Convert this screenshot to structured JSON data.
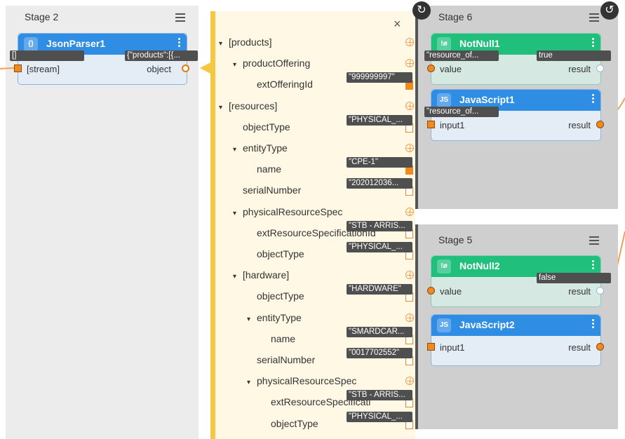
{
  "stage2": {
    "title": "Stage 2",
    "node": {
      "name": "JsonParser1",
      "icon": "{}",
      "input_label": "[stream]",
      "input_tag": "[]",
      "output_label": "object",
      "output_tag": "{\"products\":[{..."
    }
  },
  "mapper": {
    "close": "×",
    "items": [
      {
        "label": "[products]",
        "chev": "▾"
      },
      {
        "label": "productOffering",
        "chev": "▾"
      },
      {
        "label": "extOfferingId",
        "chev": "",
        "tag": "\"999999997\""
      },
      {
        "label": "[resources]",
        "chev": "▾"
      },
      {
        "label": "objectType",
        "chev": "",
        "tag": "\"PHYSICAL_..."
      },
      {
        "label": "entityType",
        "chev": "▾"
      },
      {
        "label": "name",
        "chev": "",
        "tag": "\"CPE-1\""
      },
      {
        "label": "serialNumber",
        "chev": "",
        "tag": "\"202012036..."
      },
      {
        "label": "physicalResourceSpec",
        "chev": "▾"
      },
      {
        "label": "extResourceSpecificationId",
        "chev": "",
        "tag": "\"STB - ARRIS..."
      },
      {
        "label": "objectType",
        "chev": "",
        "tag": "\"PHYSICAL_..."
      },
      {
        "label": "[hardware]",
        "chev": "▾"
      },
      {
        "label": "objectType",
        "chev": "",
        "tag": "\"HARDWARE\""
      },
      {
        "label": "entityType",
        "chev": "▾"
      },
      {
        "label": "name",
        "chev": "",
        "tag": "\"SMARDCAR..."
      },
      {
        "label": "serialNumber",
        "chev": "",
        "tag": "\"0017702552\""
      },
      {
        "label": "physicalResourceSpec",
        "chev": "▾"
      },
      {
        "label": "extResourceSpecificati",
        "chev": "",
        "tag": "\"STB - ARRIS..."
      },
      {
        "label": "objectType",
        "chev": "",
        "tag": "\"PHYSICAL_..."
      }
    ]
  },
  "stage6": {
    "title": "Stage 6",
    "nodes": [
      {
        "name": "NotNull1",
        "icon": "!ø",
        "input": "value",
        "output": "result",
        "input_tag": "\"resource_of...",
        "output_tag": "true"
      },
      {
        "name": "JavaScript1",
        "icon": "JS",
        "input": "input1",
        "output": "result",
        "input_tag": "\"resource_of..."
      }
    ]
  },
  "stage5": {
    "title": "Stage 5",
    "nodes": [
      {
        "name": "NotNull2",
        "icon": "!ø",
        "input": "value",
        "output": "result",
        "output_tag": "false"
      },
      {
        "name": "JavaScript2",
        "icon": "JS",
        "input": "input1",
        "output": "result"
      }
    ]
  },
  "colors": {
    "blue": "#2f8de4",
    "green": "#20c07c",
    "orange": "#f08a1e",
    "accent_bar": "#f5c842"
  }
}
